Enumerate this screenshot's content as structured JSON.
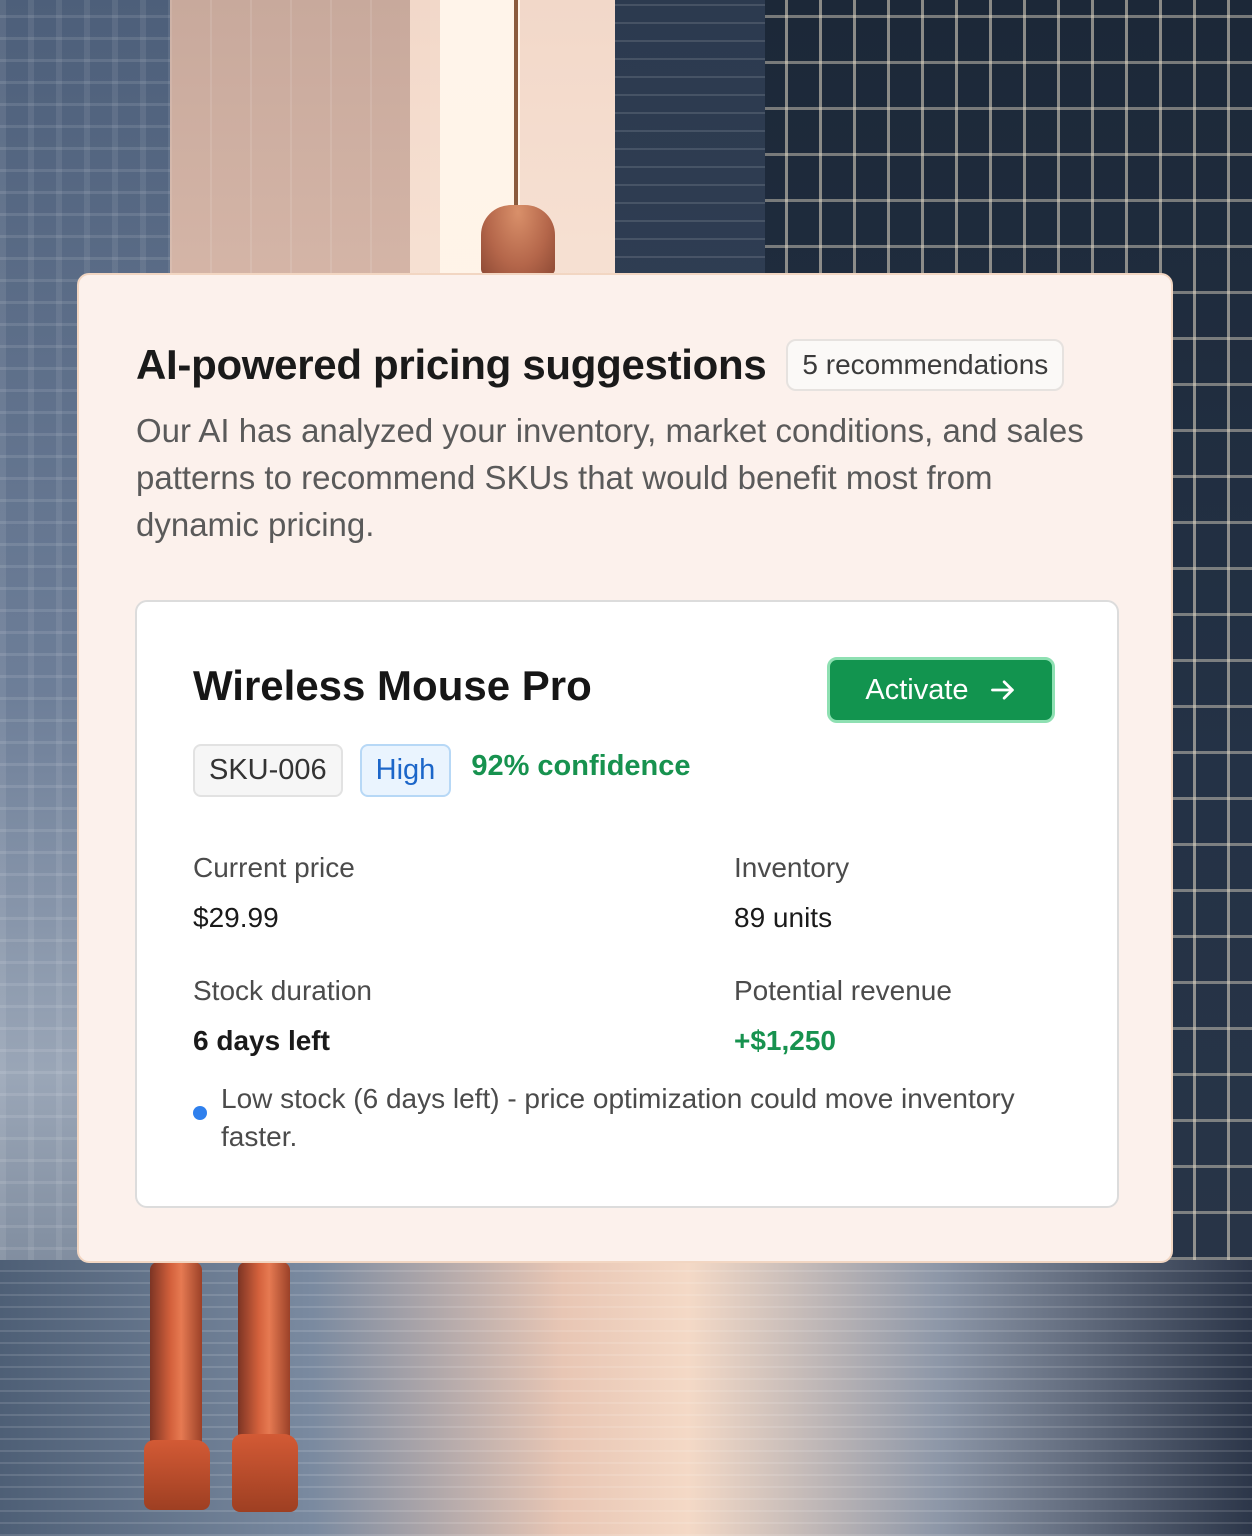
{
  "panel": {
    "title": "AI-powered pricing suggestions",
    "count_badge": "5 recommendations",
    "description": "Our AI has analyzed your inventory, market conditions, and sales patterns to recommend SKUs that would benefit most from dynamic pricing."
  },
  "card": {
    "product_name": "Wireless Mouse Pro",
    "activate_label": "Activate",
    "activate_icon": "arrow-right-icon",
    "sku": "SKU-006",
    "priority": "High",
    "confidence": "92% confidence",
    "stats": {
      "current_price_label": "Current price",
      "current_price_value": "$29.99",
      "inventory_label": "Inventory",
      "inventory_value": "89 units",
      "stock_duration_label": "Stock duration",
      "stock_duration_value": "6 days left",
      "potential_revenue_label": "Potential revenue",
      "potential_revenue_value": "+$1,250"
    },
    "note": "Low stock (6 days left) - price optimization could move inventory faster."
  },
  "colors": {
    "accent_green": "#12944f",
    "confidence_green": "#17924f",
    "priority_blue": "#1c66c9",
    "note_dot_blue": "#2f80ed",
    "panel_bg": "#fcf1ec"
  }
}
